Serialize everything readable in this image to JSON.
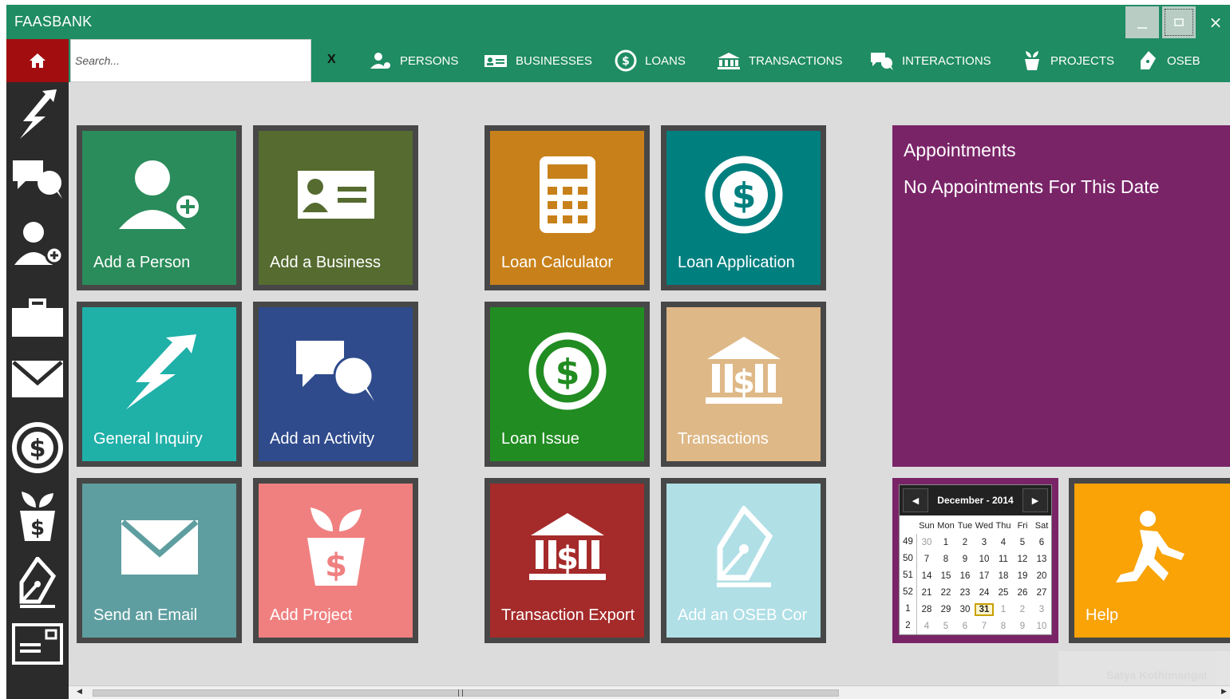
{
  "window": {
    "title": "FAASBANK",
    "controls": {
      "minimize": "minimize",
      "maximize": "maximize",
      "close": "×"
    }
  },
  "nav": {
    "search_placeholder": "Search...",
    "clear_label": "X",
    "items": [
      {
        "label": "PERSONS",
        "icon": "person-icon"
      },
      {
        "label": "BUSINESSES",
        "icon": "id-card-icon"
      },
      {
        "label": "LOANS",
        "icon": "dollar-coin-icon"
      },
      {
        "label": "TRANSACTIONS",
        "icon": "bank-icon"
      },
      {
        "label": "INTERACTIONS",
        "icon": "chat-bubbles-icon"
      },
      {
        "label": "PROJECTS",
        "icon": "plant-pot-icon"
      },
      {
        "label": "OSEB",
        "icon": "pen-nib-icon"
      }
    ]
  },
  "sidebar": {
    "icons": [
      "lightning-arrow-icon",
      "chat-bubbles-icon",
      "add-person-icon",
      "briefcase-icon",
      "envelope-icon",
      "dollar-coin-icon",
      "plant-pot-icon",
      "pen-nib-icon",
      "card-icon"
    ]
  },
  "tiles": [
    {
      "label": "Add a Person",
      "color": "#2a8c5b"
    },
    {
      "label": "Add a Business",
      "color": "#556b2f"
    },
    {
      "label": "Loan Calculator",
      "color": "#c8811a"
    },
    {
      "label": "Loan Application",
      "color": "#007f7f"
    },
    {
      "label": "General Inquiry",
      "color": "#1fb0a8"
    },
    {
      "label": "Add an Activity",
      "color": "#2f4b8c"
    },
    {
      "label": "Loan Issue",
      "color": "#218c21"
    },
    {
      "label": "Transactions",
      "color": "#deb887"
    },
    {
      "label": "Send an Email",
      "color": "#5f9ea0"
    },
    {
      "label": "Add Project",
      "color": "#f08080"
    },
    {
      "label": "Transaction Export",
      "color": "#a52a2a"
    },
    {
      "label": "Add an OSEB Cor",
      "color": "#b0dfe6"
    }
  ],
  "appointments": {
    "title": "Appointments",
    "message": "No Appointments For This Date",
    "color": "#7a2468"
  },
  "calendar": {
    "month_label": "December - 2014",
    "prev": "◀",
    "next": "▶",
    "days_of_week": [
      "Sun",
      "Mon",
      "Tue",
      "Wed",
      "Thu",
      "Fri",
      "Sat"
    ],
    "weeks": [
      {
        "week": "49",
        "days": [
          "30",
          "1",
          "2",
          "3",
          "4",
          "5",
          "6"
        ]
      },
      {
        "week": "50",
        "days": [
          "7",
          "8",
          "9",
          "10",
          "11",
          "12",
          "13"
        ]
      },
      {
        "week": "51",
        "days": [
          "14",
          "15",
          "16",
          "17",
          "18",
          "19",
          "20"
        ]
      },
      {
        "week": "52",
        "days": [
          "21",
          "22",
          "23",
          "24",
          "25",
          "26",
          "27"
        ]
      },
      {
        "week": "1",
        "days": [
          "28",
          "29",
          "30",
          "31",
          "1",
          "2",
          "3"
        ]
      },
      {
        "week": "2",
        "days": [
          "4",
          "5",
          "6",
          "7",
          "8",
          "9",
          "10"
        ]
      }
    ],
    "today": "31"
  },
  "help": {
    "label": "Help",
    "color": "#f9a307"
  },
  "toast": {
    "name": "Satya Kothimangal"
  }
}
